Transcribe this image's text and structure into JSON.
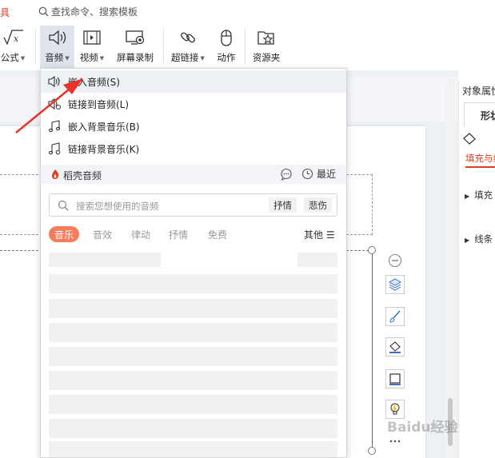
{
  "topbar": {
    "tools_tab": "工具",
    "command_search": "查找命令、搜索模板"
  },
  "ribbon": {
    "formula": "公式",
    "audio": "音频",
    "video": "视频",
    "screen_record": "屏幕录制",
    "hyperlink": "超链接",
    "action": "动作",
    "resources": "资源夹"
  },
  "audio_menu": {
    "items": [
      {
        "label": "嵌入音频(S)",
        "icon": "speaker-icon"
      },
      {
        "label": "链接到音频(L)",
        "icon": "speaker-link-icon"
      },
      {
        "label": "嵌入背景音乐(B)",
        "icon": "music-note-icon"
      },
      {
        "label": "链接背景音乐(K)",
        "icon": "music-note-link-icon"
      }
    ],
    "docer": {
      "name": "稻壳音频",
      "recent": "最近",
      "search_placeholder": "搜索您想使用的音频",
      "suggestions": [
        "抒情",
        "悲伤"
      ],
      "categories": [
        "音乐",
        "音效",
        "律动",
        "抒情",
        "免费"
      ],
      "more": "其他"
    }
  },
  "right_panel": {
    "title": "对象属性",
    "tab": "形状",
    "fill_tab": "填充与线条",
    "rows": [
      "填充",
      "线条"
    ]
  },
  "colors": {
    "accent": "#e2401b",
    "category_active": "#f87b5b",
    "arrow": "#e8322a"
  },
  "watermark": "Baidu经验"
}
